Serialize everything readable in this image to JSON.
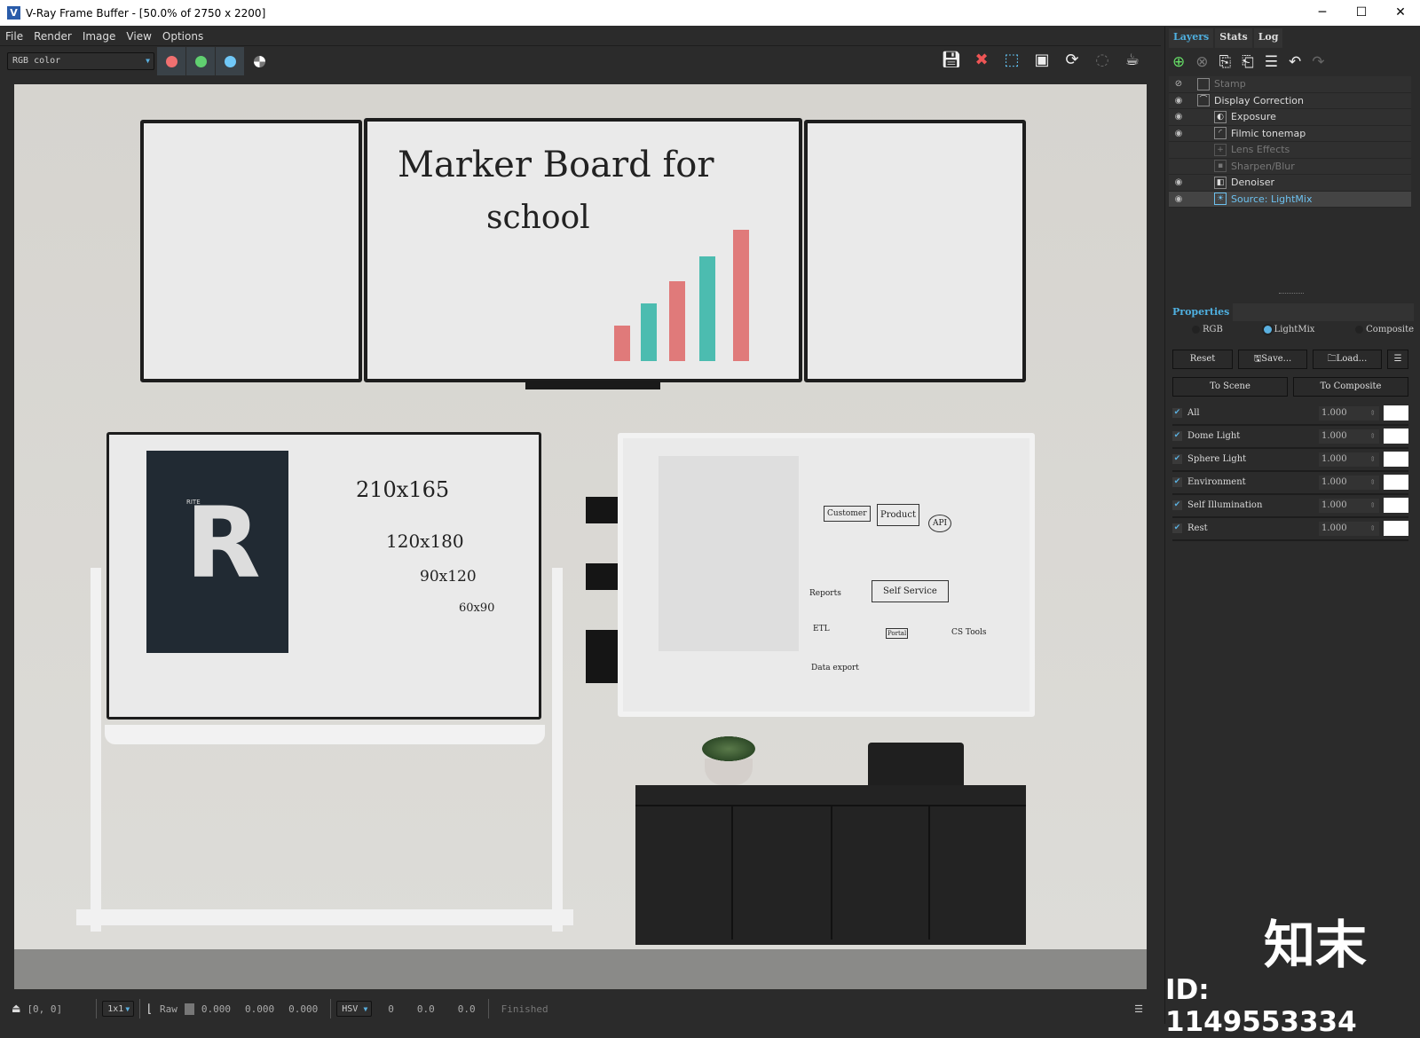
{
  "window": {
    "title": "V-Ray Frame Buffer - [50.0% of 2750 x 2200]",
    "minimize": "─",
    "maximize": "☐",
    "close": "✕"
  },
  "menu": [
    "File",
    "Render",
    "Image",
    "View",
    "Options"
  ],
  "toolbar": {
    "channel": "RGB color",
    "colors": {
      "red": "#f07070",
      "green": "#60d070",
      "blue": "#70c8f8"
    }
  },
  "render": {
    "board_title_1": "Marker Board for",
    "board_title_2": "school",
    "sizes": [
      "210x165",
      "120x180",
      "90x120",
      "60x90"
    ],
    "poster_letter": "R",
    "poster_small": "RITE",
    "diagram": [
      "Customer",
      "Product",
      "API",
      "Self Service",
      "Portal",
      "CS Tools",
      "ETL",
      "Reports",
      "Data export"
    ]
  },
  "status": {
    "coords": "[0, 0]",
    "sample": "1x1",
    "raw_label": "Raw",
    "rgb": [
      "0.000",
      "0.000",
      "0.000"
    ],
    "color_mode": "HSV",
    "hsv": [
      "0",
      "0.0",
      "0.0"
    ],
    "state": "Finished"
  },
  "panel": {
    "tabs": [
      "Layers",
      "Stats",
      "Log"
    ],
    "layers": [
      {
        "name": "Stamp",
        "state": "disabled"
      },
      {
        "name": "Display Correction",
        "state": "visible"
      },
      {
        "name": "Exposure",
        "state": "visible"
      },
      {
        "name": "Filmic tonemap",
        "state": "visible"
      },
      {
        "name": "Lens Effects",
        "state": "disabled"
      },
      {
        "name": "Sharpen/Blur",
        "state": "disabled"
      },
      {
        "name": "Denoiser",
        "state": "visible"
      },
      {
        "name": "Source: LightMix",
        "state": "selected"
      }
    ],
    "properties_label": "Properties",
    "modes": [
      "RGB",
      "LightMix",
      "Composite"
    ],
    "selected_mode": "LightMix",
    "buttons": {
      "reset": "Reset",
      "save": "Save...",
      "load": "Load...",
      "to_scene": "To Scene",
      "to_composite": "To Composite"
    },
    "lights": [
      {
        "name": "All",
        "value": "1.000",
        "checked": true
      },
      {
        "name": "Dome Light",
        "value": "1.000",
        "checked": true
      },
      {
        "name": "Sphere Light",
        "value": "1.000",
        "checked": true
      },
      {
        "name": "Environment",
        "value": "1.000",
        "checked": true
      },
      {
        "name": "Self Illumination",
        "value": "1.000",
        "checked": true
      },
      {
        "name": "Rest",
        "value": "1.000",
        "checked": true
      }
    ]
  },
  "watermark": {
    "logo": "知末",
    "id": "ID: 1149553334"
  }
}
